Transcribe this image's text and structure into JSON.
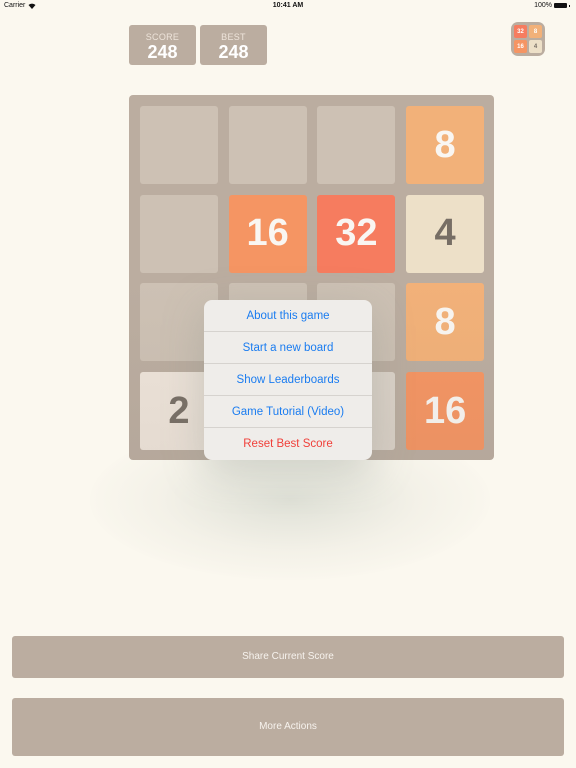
{
  "status_bar": {
    "carrier": "Carrier",
    "time": "10:41 AM",
    "battery": "100%"
  },
  "scores": {
    "score": {
      "label": "SCORE",
      "value": "248"
    },
    "best": {
      "label": "BEST",
      "value": "248"
    }
  },
  "app_icon": {
    "tiles": [
      "32",
      "8",
      "16",
      "4"
    ]
  },
  "board": {
    "size": 4,
    "rows": [
      [
        "",
        "",
        "",
        "8"
      ],
      [
        "",
        "16",
        "32",
        "4"
      ],
      [
        "",
        "",
        "",
        "8"
      ],
      [
        "2",
        "",
        "",
        "16"
      ]
    ]
  },
  "menu": {
    "items": [
      {
        "label": "About this game",
        "style": "default"
      },
      {
        "label": "Start a new board",
        "style": "default"
      },
      {
        "label": "Show Leaderboards",
        "style": "default"
      },
      {
        "label": "Game Tutorial (Video)",
        "style": "default"
      },
      {
        "label": "Reset Best Score",
        "style": "destructive"
      }
    ]
  },
  "buttons": {
    "share": "Share Current Score",
    "more": "More Actions"
  },
  "colors": {
    "background": "#fbf8ef",
    "board": "#bbada0",
    "empty_cell": "#cdc1b4",
    "menu_link": "#1a7cf0",
    "menu_destructive": "#f0403a"
  }
}
